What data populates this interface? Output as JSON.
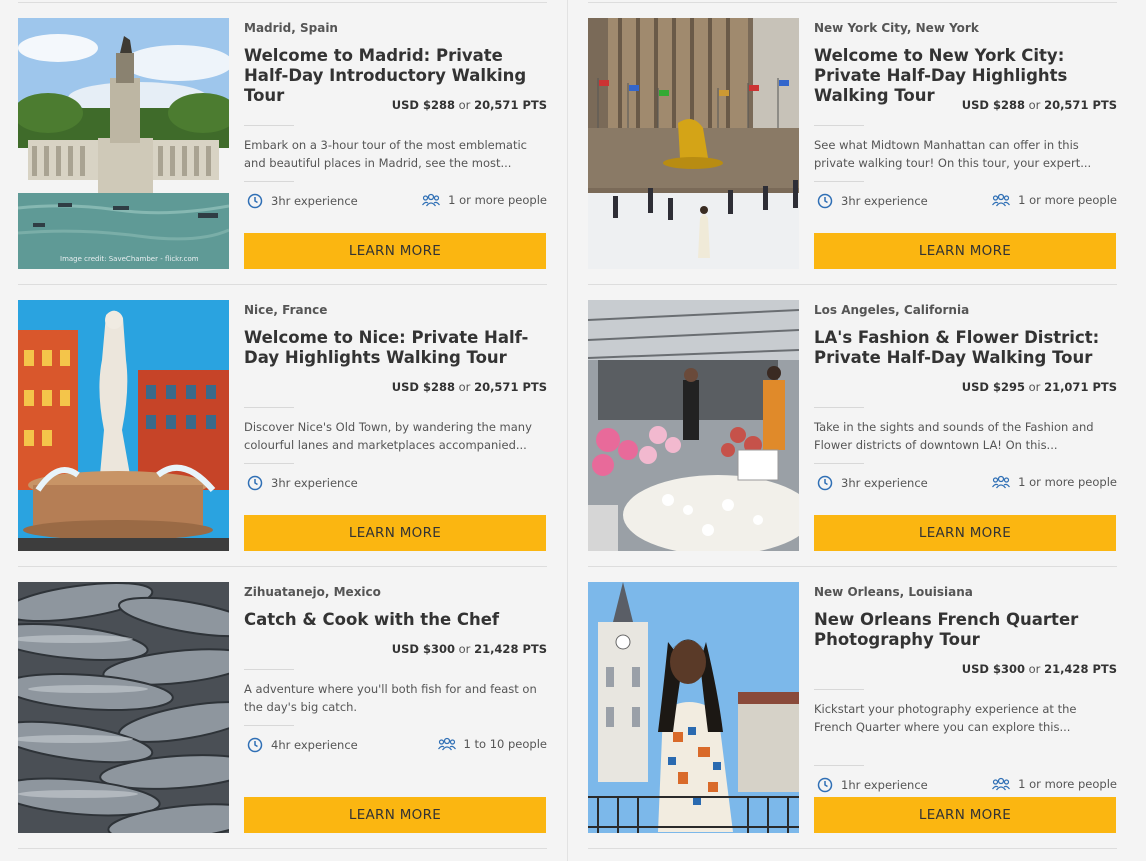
{
  "colors": {
    "button": "#fbb611",
    "icon": "#2f6fb5",
    "background": "#f4f4f4"
  },
  "left_column": [
    {
      "location": "Madrid, Spain",
      "title": "Welcome to Madrid: Private Half-Day Introductory Walking Tour",
      "price_usd": "USD $288",
      "price_or": "or",
      "price_pts": "20,571 PTS",
      "description": "Embark on a 3-hour tour of the most emblematic and beautiful places in Madrid, see the most...",
      "duration": "3hr experience",
      "people": "1 or more people",
      "button": "LEARN MORE",
      "image_credit": "Image credit: SaveChamber - flickr.com",
      "image_icon": "madrid-monument-photo"
    },
    {
      "location": "Nice, France",
      "title": "Welcome to Nice: Private Half-Day Highlights Walking Tour",
      "price_usd": "USD $288",
      "price_or": "or",
      "price_pts": "20,571 PTS",
      "description": "Discover Nice's Old Town, by wandering the many colourful lanes and marketplaces accompanied...",
      "duration": "3hr experience",
      "people": "",
      "button": "LEARN MORE",
      "image_icon": "nice-fountain-photo"
    },
    {
      "location": "Zihuatanejo, Mexico",
      "title": "Catch & Cook with the Chef",
      "price_usd": "USD $300",
      "price_or": "or",
      "price_pts": "21,428 PTS",
      "description": "A adventure where you'll both fish for and feast on the day's big catch.",
      "duration": "4hr experience",
      "people": "1 to 10 people",
      "button": "LEARN MORE",
      "image_icon": "fish-photo"
    }
  ],
  "right_column": [
    {
      "location": "New York City, New York",
      "title": "Welcome to New York City: Private Half-Day Highlights Walking Tour",
      "price_usd": "USD $288",
      "price_or": "or",
      "price_pts": "20,571 PTS",
      "description": "See what Midtown Manhattan can offer in this private walking tour! On this tour, your expert...",
      "duration": "3hr experience",
      "people": "1 or more people",
      "button": "LEARN MORE",
      "image_icon": "rockefeller-rink-photo"
    },
    {
      "location": "Los Angeles, California",
      "title": "LA's Fashion & Flower District: Private Half-Day Walking Tour",
      "price_usd": "USD $295",
      "price_or": "or",
      "price_pts": "21,071 PTS",
      "description": "Take in the sights and sounds of the Fashion and Flower districts of downtown LA! On this...",
      "duration": "3hr experience",
      "people": "1 or more people",
      "button": "LEARN MORE",
      "image_icon": "flower-market-photo"
    },
    {
      "location": "New Orleans, Louisiana",
      "title": "New Orleans French Quarter Photography Tour",
      "price_usd": "USD $300",
      "price_or": "or",
      "price_pts": "21,428 PTS",
      "description": "Kickstart your photography experience at the French Quarter where you can explore this...",
      "duration": "1hr experience",
      "people": "1 or more people",
      "button": "LEARN MORE",
      "image_icon": "new-orleans-portrait-photo"
    }
  ]
}
